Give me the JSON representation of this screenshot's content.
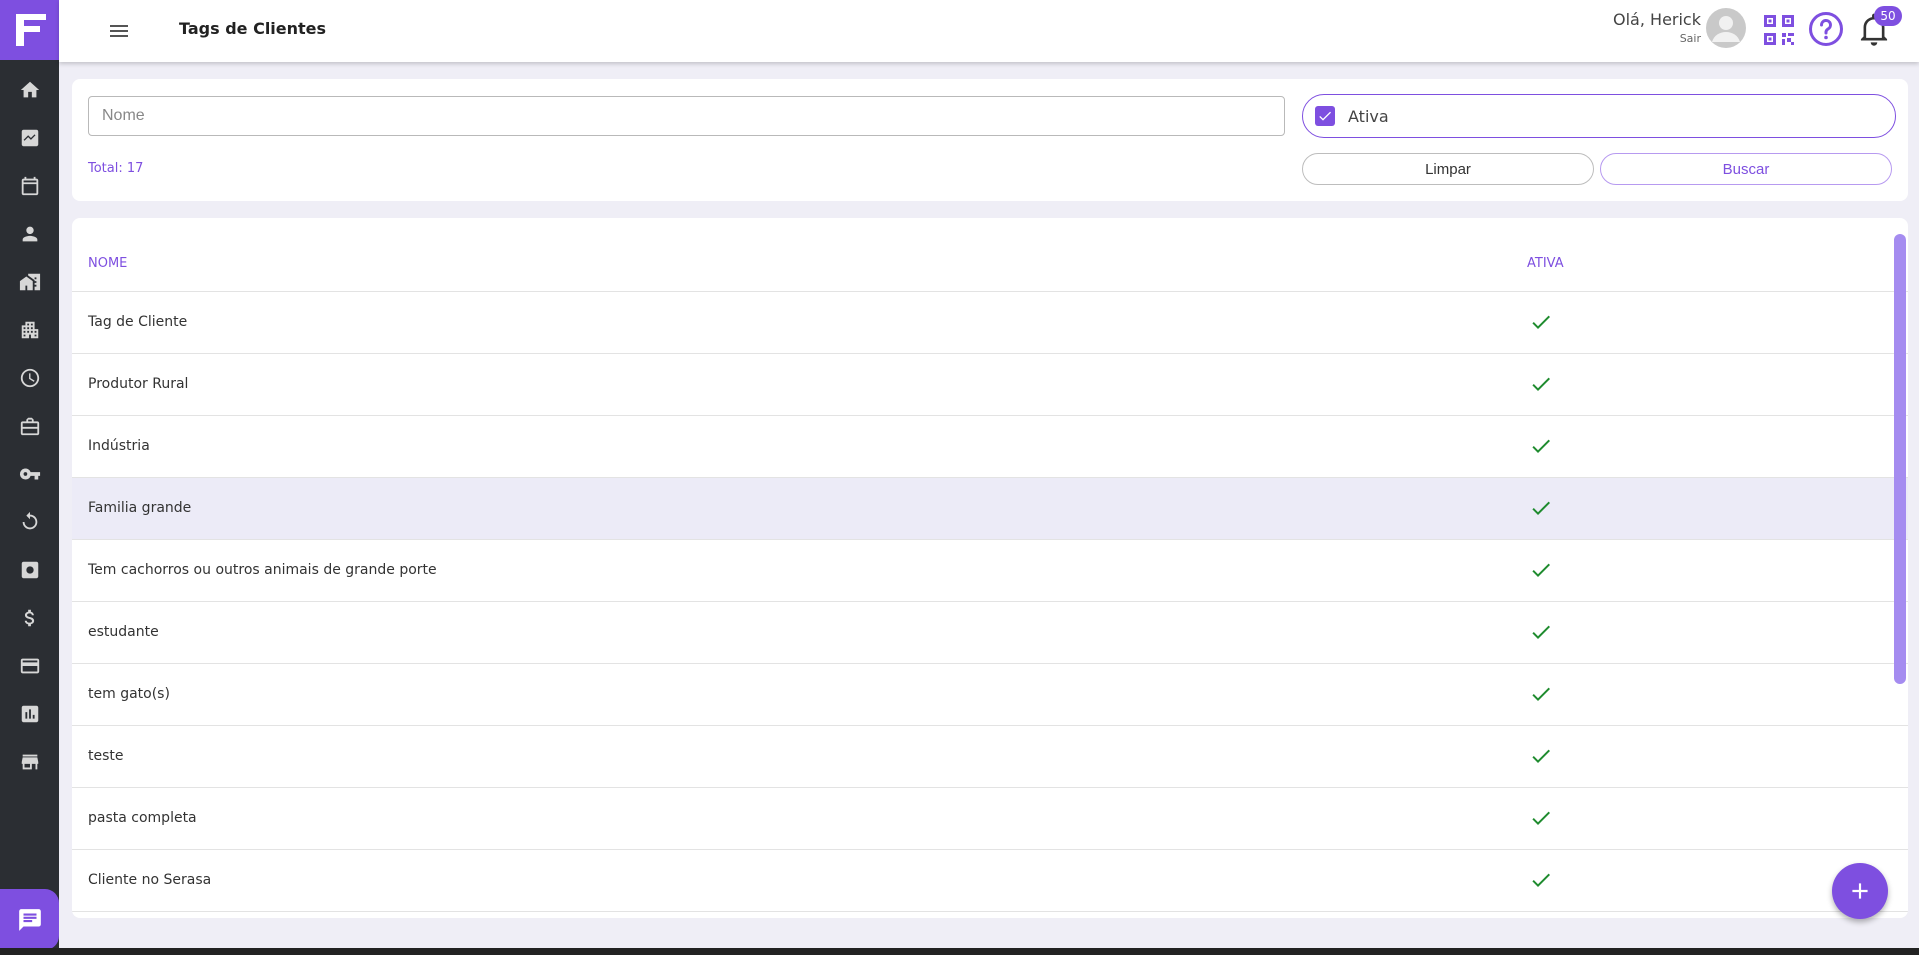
{
  "app": {
    "title": "Tags de Clientes",
    "accent_color": "#7e4fe0",
    "sidebar_color": "#2b2e33"
  },
  "sidebar": {
    "items": [
      {
        "icon": "home-icon"
      },
      {
        "icon": "chart-icon"
      },
      {
        "icon": "calendar-icon"
      },
      {
        "icon": "person-icon"
      },
      {
        "icon": "building-icon"
      },
      {
        "icon": "office-building-icon"
      },
      {
        "icon": "clock-icon"
      },
      {
        "icon": "briefcase-icon"
      },
      {
        "icon": "key-icon"
      },
      {
        "icon": "refresh-icon"
      },
      {
        "icon": "settings-box-icon"
      },
      {
        "icon": "dollar-icon"
      },
      {
        "icon": "credit-card-icon"
      },
      {
        "icon": "bar-chart-icon"
      },
      {
        "icon": "store-icon"
      }
    ]
  },
  "header": {
    "greeting": "Olá, Herick",
    "logout": "Sair",
    "notifications_count": "50"
  },
  "filters": {
    "name_placeholder": "Nome",
    "name_value": "",
    "active_label": "Ativa",
    "active_checked": true,
    "total_text": "Total: 17",
    "clear_label": "Limpar",
    "search_label": "Buscar"
  },
  "table": {
    "columns": [
      "NOME",
      "ATIVA"
    ],
    "rows": [
      {
        "name": "Tag de Cliente",
        "active": true
      },
      {
        "name": "Produtor Rural",
        "active": true
      },
      {
        "name": "Indústria",
        "active": true
      },
      {
        "name": "Familia grande",
        "active": true
      },
      {
        "name": "Tem cachorros ou outros animais de grande porte",
        "active": true
      },
      {
        "name": "estudante",
        "active": true
      },
      {
        "name": "tem gato(s)",
        "active": true
      },
      {
        "name": "teste",
        "active": true
      },
      {
        "name": "pasta completa",
        "active": true
      },
      {
        "name": "Cliente no Serasa",
        "active": true
      }
    ]
  }
}
